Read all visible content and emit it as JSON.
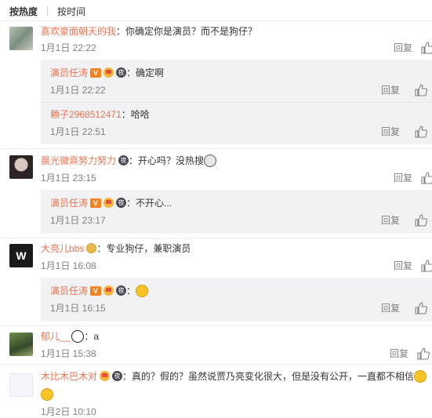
{
  "sort": {
    "by_hot": "按热度",
    "by_time": "按时间"
  },
  "comments": [
    {
      "user": "喜欢豪面朝天的我",
      "text": "：你确定你是演员？而不是狗仔？",
      "time": "1月1日 22:22",
      "reply": "回复",
      "replies": [
        {
          "user": "演员任涛",
          "text": "：确定啊",
          "time": "1月1日 22:22",
          "reply": "回复"
        },
        {
          "user": "赖子2968512471",
          "text": "：哈哈",
          "time": "1月1日 22:51",
          "reply": "回复"
        }
      ]
    },
    {
      "user": "晨光微熹努力努力",
      "text": "：开心吗？没热搜",
      "time": "1月1日 23:15",
      "reply": "回复",
      "replies": [
        {
          "user": "演员任涛",
          "text": "：不开心...",
          "time": "1月1日 23:17",
          "reply": "回复"
        }
      ]
    },
    {
      "user": "大亮儿bbs",
      "text": "：专业狗仔，兼职演员",
      "time": "1月1日 16:08",
      "reply": "回复",
      "avatar_letter": "W",
      "replies": [
        {
          "user": "演员任涛",
          "text": "：",
          "time": "1月1日 16:15",
          "reply": "回复"
        }
      ]
    },
    {
      "user": "郁儿__",
      "text": "：a",
      "time": "1月1日 15:38",
      "reply": "回复"
    },
    {
      "user": "木比木巴木对",
      "text": "：真的？假的？虽然说贾乃亮变化很大，但是没有公开，一直都不相信",
      "time": "1月2日 10:10"
    }
  ],
  "badges": {
    "v_label": "V",
    "night_label": "夜"
  },
  "colors": {
    "username": "#eb7350",
    "meta": "#808080",
    "reply_bg": "#f2f2f5"
  }
}
